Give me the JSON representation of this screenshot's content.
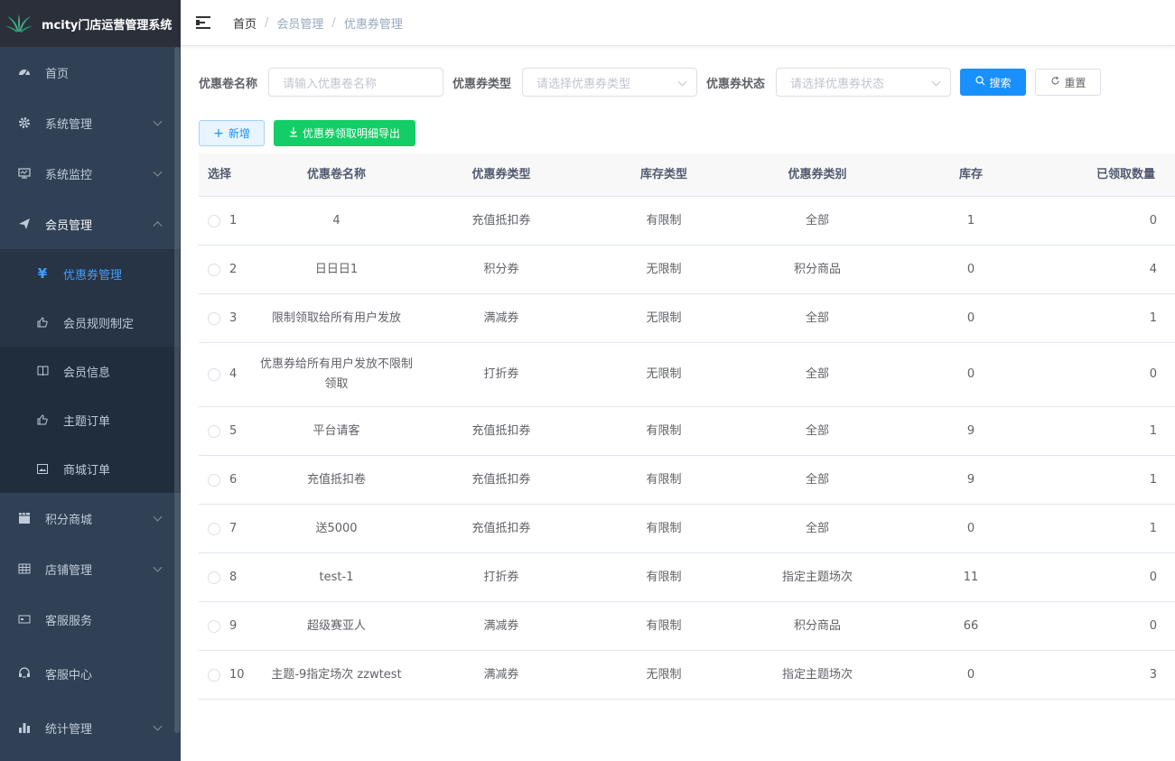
{
  "app": {
    "title": "mcity门店运营管理系统"
  },
  "sidebar": {
    "items": [
      {
        "label": "首页",
        "icon": "dashboard-icon"
      },
      {
        "label": "系统管理",
        "icon": "gear-icon",
        "expandable": true
      },
      {
        "label": "系统监控",
        "icon": "monitor-icon",
        "expandable": true
      },
      {
        "label": "会员管理",
        "icon": "paper-plane-icon",
        "expandable": true,
        "open": true,
        "children": [
          {
            "label": "优惠券管理",
            "icon": "yen-icon",
            "active": true
          },
          {
            "label": "会员规则制定",
            "icon": "thumbs-up-icon"
          },
          {
            "label": "会员信息",
            "icon": "book-icon"
          },
          {
            "label": "主题订单",
            "icon": "thumbs-up-icon"
          },
          {
            "label": "商城订单",
            "icon": "picture-icon"
          }
        ]
      },
      {
        "label": "积分商城",
        "icon": "clapperboard-icon",
        "expandable": true
      },
      {
        "label": "店铺管理",
        "icon": "grid-icon",
        "expandable": true
      },
      {
        "label": "客服服务",
        "icon": "card-icon"
      },
      {
        "label": "客服中心",
        "icon": "headset-icon"
      },
      {
        "label": "统计管理",
        "icon": "bar-chart-icon",
        "expandable": true
      }
    ]
  },
  "header": {
    "breadcrumb": [
      "首页",
      "会员管理",
      "优惠券管理"
    ]
  },
  "filters": {
    "name_label": "优惠卷名称",
    "name_placeholder": "请输入优惠卷名称",
    "type_label": "优惠券类型",
    "type_placeholder": "请选择优惠券类型",
    "status_label": "优惠券状态",
    "status_placeholder": "请选择优惠券状态",
    "search_label": "搜索",
    "reset_label": "重置"
  },
  "actions": {
    "add_label": "新增",
    "export_label": "优惠券领取明细导出"
  },
  "table": {
    "headers": [
      "选择",
      "优惠卷名称",
      "优惠券类型",
      "库存类型",
      "优惠券类别",
      "库存",
      "已领取数量"
    ],
    "rows": [
      [
        "1",
        "4",
        "充值抵扣券",
        "有限制",
        "全部",
        "1",
        "0"
      ],
      [
        "2",
        "日日日1",
        "积分券",
        "无限制",
        "积分商品",
        "0",
        "4"
      ],
      [
        "3",
        "限制领取给所有用户发放",
        "满减券",
        "无限制",
        "全部",
        "0",
        "1"
      ],
      [
        "4",
        "优惠券给所有用户发放不限制领取",
        "打折券",
        "无限制",
        "全部",
        "0",
        "0"
      ],
      [
        "5",
        "平台请客",
        "充值抵扣券",
        "有限制",
        "全部",
        "9",
        "1"
      ],
      [
        "6",
        "充值抵扣卷",
        "充值抵扣券",
        "有限制",
        "全部",
        "9",
        "1"
      ],
      [
        "7",
        "送5000",
        "充值抵扣券",
        "有限制",
        "全部",
        "0",
        "1"
      ],
      [
        "8",
        "test-1",
        "打折券",
        "有限制",
        "指定主题场次",
        "11",
        "0"
      ],
      [
        "9",
        "超级赛亚人",
        "满减券",
        "有限制",
        "积分商品",
        "66",
        "0"
      ],
      [
        "10",
        "主题-9指定场次 zzwtest",
        "满减券",
        "无限制",
        "指定主题场次",
        "0",
        "3"
      ]
    ]
  },
  "colors": {
    "sidebar_bg": "#304156",
    "accent": "#1890ff",
    "success": "#13ce66"
  }
}
